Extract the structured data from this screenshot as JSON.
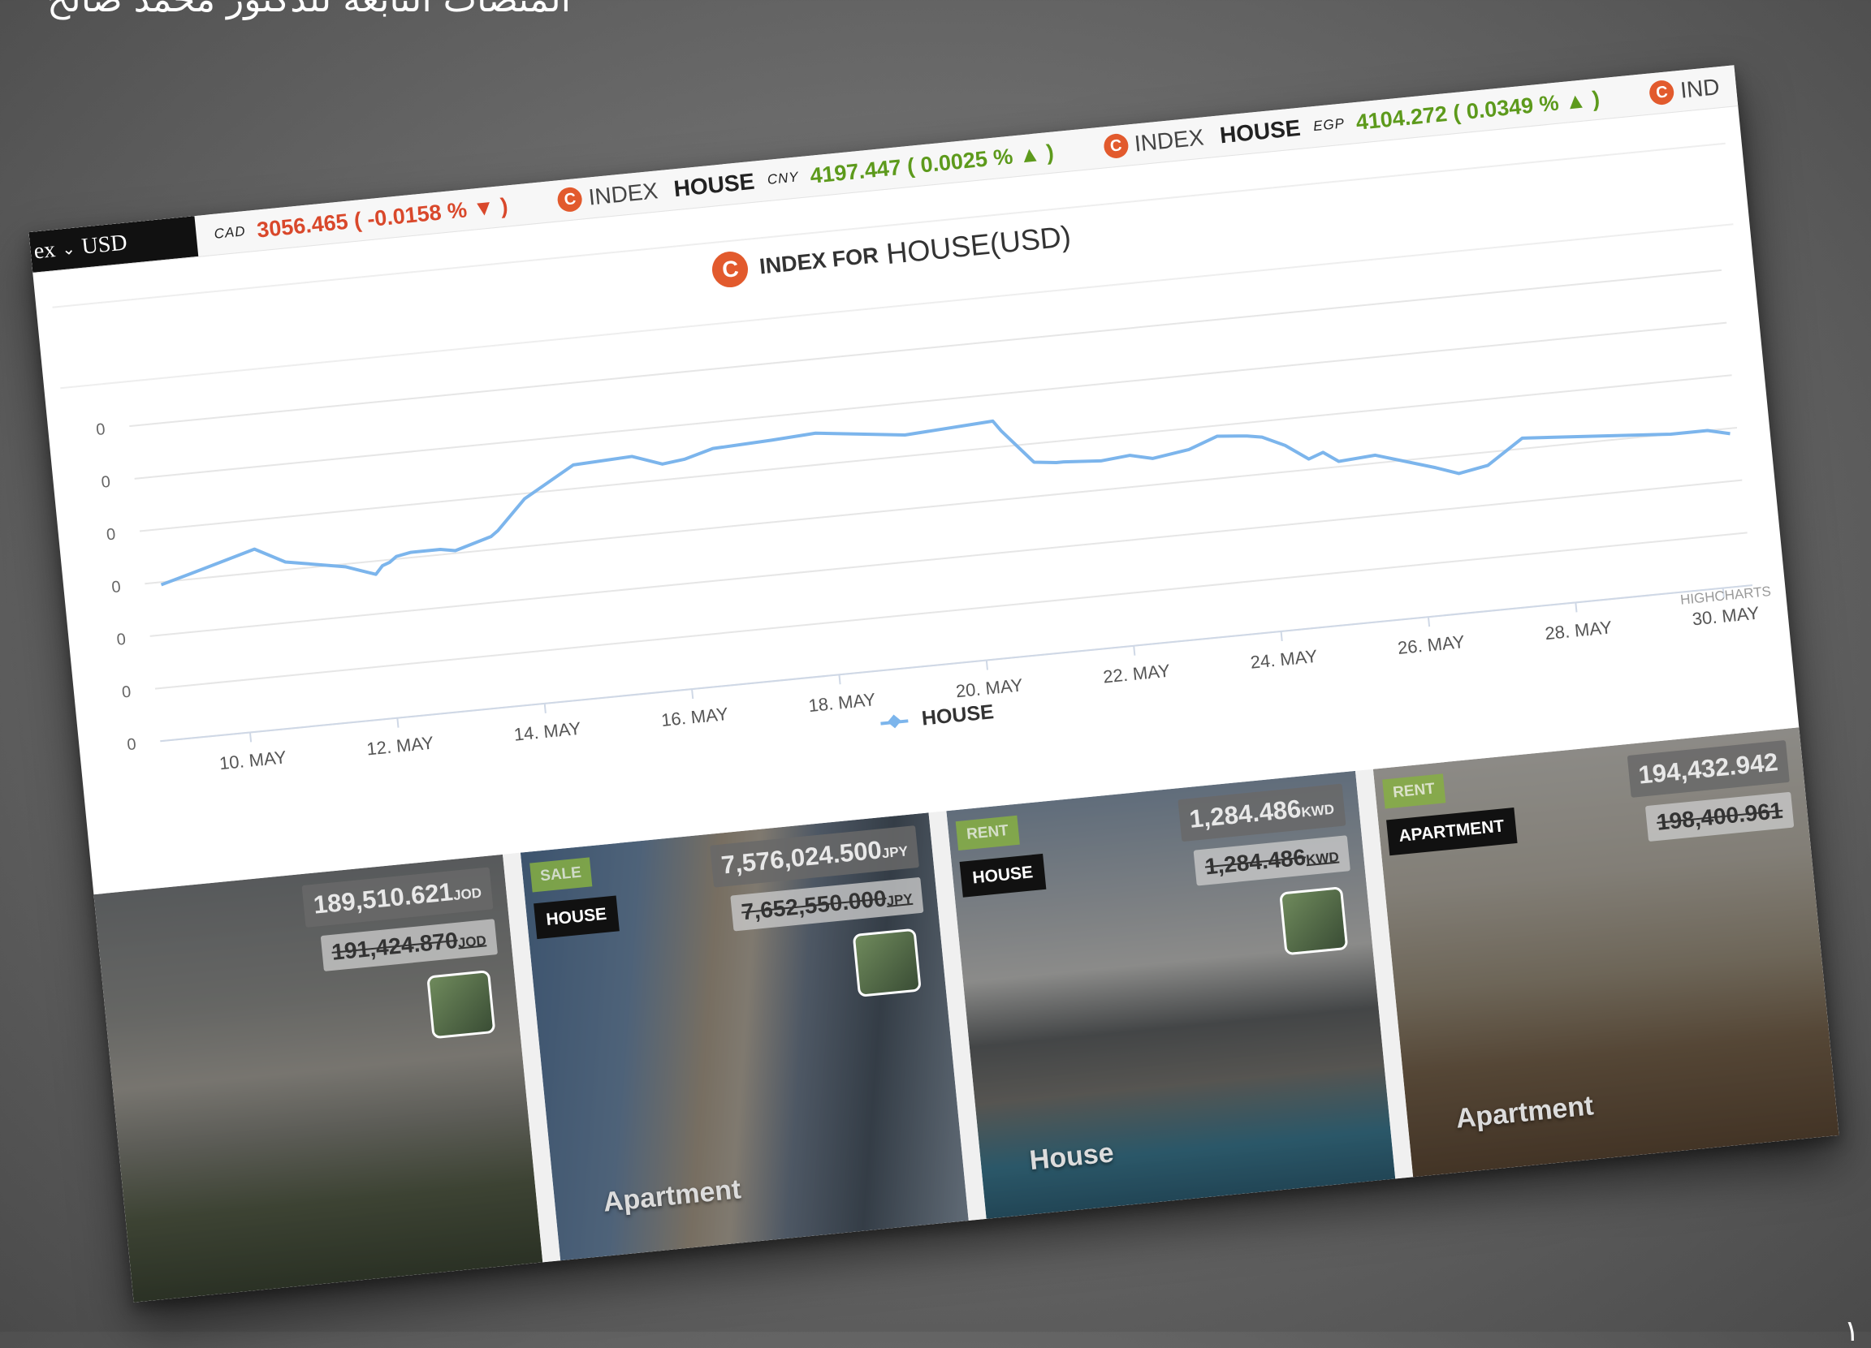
{
  "slide": {
    "caption": "المنصات التابعة للدكتور محمد صالح",
    "corner_mark": "١"
  },
  "ticker": {
    "currency_selector": {
      "prefix": "ex",
      "value": "USD"
    },
    "items": [
      {
        "brand": "",
        "name": "",
        "currency": "CAD",
        "value": "3056.465 ( -0.0158 % ▼ )",
        "trend": "down"
      },
      {
        "brand": "INDEX",
        "name": "HOUSE",
        "currency": "CNY",
        "value": "4197.447 ( 0.0025 % ▲ )",
        "trend": "up"
      },
      {
        "brand": "INDEX",
        "name": "HOUSE",
        "currency": "EGP",
        "value": "4104.272 ( 0.0349 % ▲ )",
        "trend": "up"
      },
      {
        "brand": "IND",
        "name": "",
        "currency": "",
        "value": "",
        "trend": ""
      }
    ],
    "colors": {
      "up": "#5d9a1c",
      "down": "#d9482b",
      "logo": "#e25a2d"
    }
  },
  "chart": {
    "logo_letter": "C",
    "title_prefix": "INDEX FOR",
    "title_main": "HOUSE(USD)",
    "credits": "HIGHCHARTS",
    "legend_label": "HOUSE"
  },
  "chart_data": {
    "type": "line",
    "title": "INDEX FOR HOUSE(USD)",
    "xlabel": "",
    "ylabel": "",
    "x_ticks": [
      "10. MAY",
      "12. MAY",
      "14. MAY",
      "16. MAY",
      "18. MAY",
      "20. MAY",
      "22. MAY",
      "24. MAY",
      "26. MAY",
      "28. MAY",
      "30. MAY"
    ],
    "y_ticks": [
      "0",
      "0",
      "0",
      "0",
      "0",
      "0",
      "0"
    ],
    "xlim": [
      9.0,
      30.4
    ],
    "ylim": [
      0,
      6
    ],
    "grid": true,
    "legend": "bottom-center",
    "series": [
      {
        "name": "HOUSE",
        "color": "#7cb5ec",
        "x": [
          9.0,
          9.4,
          10.3,
          10.7,
          11.5,
          11.7,
          11.9,
          12.0,
          12.1,
          12.2,
          12.4,
          12.8,
          13.0,
          13.5,
          13.6,
          14.0,
          14.7,
          15.5,
          15.9,
          16.2,
          16.6,
          17.4,
          18.0,
          19.2,
          20.4,
          20.5,
          20.9,
          21.2,
          21.3,
          21.8,
          22.2,
          22.5,
          23.0,
          23.4,
          23.8,
          24.0,
          24.3,
          24.6,
          24.8,
          25.0,
          25.5,
          26.3,
          26.6,
          27.0,
          27.5,
          28.5,
          29.5,
          30.0,
          30.3
        ],
        "y": [
          2.95,
          3.1,
          3.45,
          3.15,
          2.95,
          2.85,
          2.75,
          2.9,
          2.95,
          3.05,
          3.1,
          3.1,
          3.05,
          3.25,
          3.35,
          3.9,
          4.45,
          4.5,
          4.3,
          4.35,
          4.5,
          4.55,
          4.6,
          4.4,
          4.5,
          4.3,
          3.65,
          3.6,
          3.6,
          3.55,
          3.6,
          3.5,
          3.6,
          3.8,
          3.75,
          3.7,
          3.5,
          3.2,
          3.3,
          3.1,
          3.15,
          2.8,
          2.65,
          2.75,
          3.2,
          3.1,
          3.0,
          3.0,
          2.9
        ]
      }
    ]
  },
  "listings": [
    {
      "status": "",
      "type": "",
      "price_current": "189,510.621",
      "price_current_unit": "JOD",
      "price_old": "191,424.870",
      "price_old_unit": "JOD",
      "label": ""
    },
    {
      "status": "SALE",
      "type": "HOUSE",
      "price_current": "7,576,024.500",
      "price_current_unit": "JPY",
      "price_old": "7,652,550.000",
      "price_old_unit": "JPY",
      "label": "Apartment"
    },
    {
      "status": "RENT",
      "type": "HOUSE",
      "price_current": "1,284.486",
      "price_current_unit": "KWD",
      "price_old": "1,284.486",
      "price_old_unit": "KWD",
      "label": "House"
    },
    {
      "status": "RENT",
      "type": "APARTMENT",
      "price_current": "194,432.942",
      "price_current_unit": "",
      "price_old": "198,400.961",
      "price_old_unit": "",
      "label": "Apartment"
    }
  ]
}
